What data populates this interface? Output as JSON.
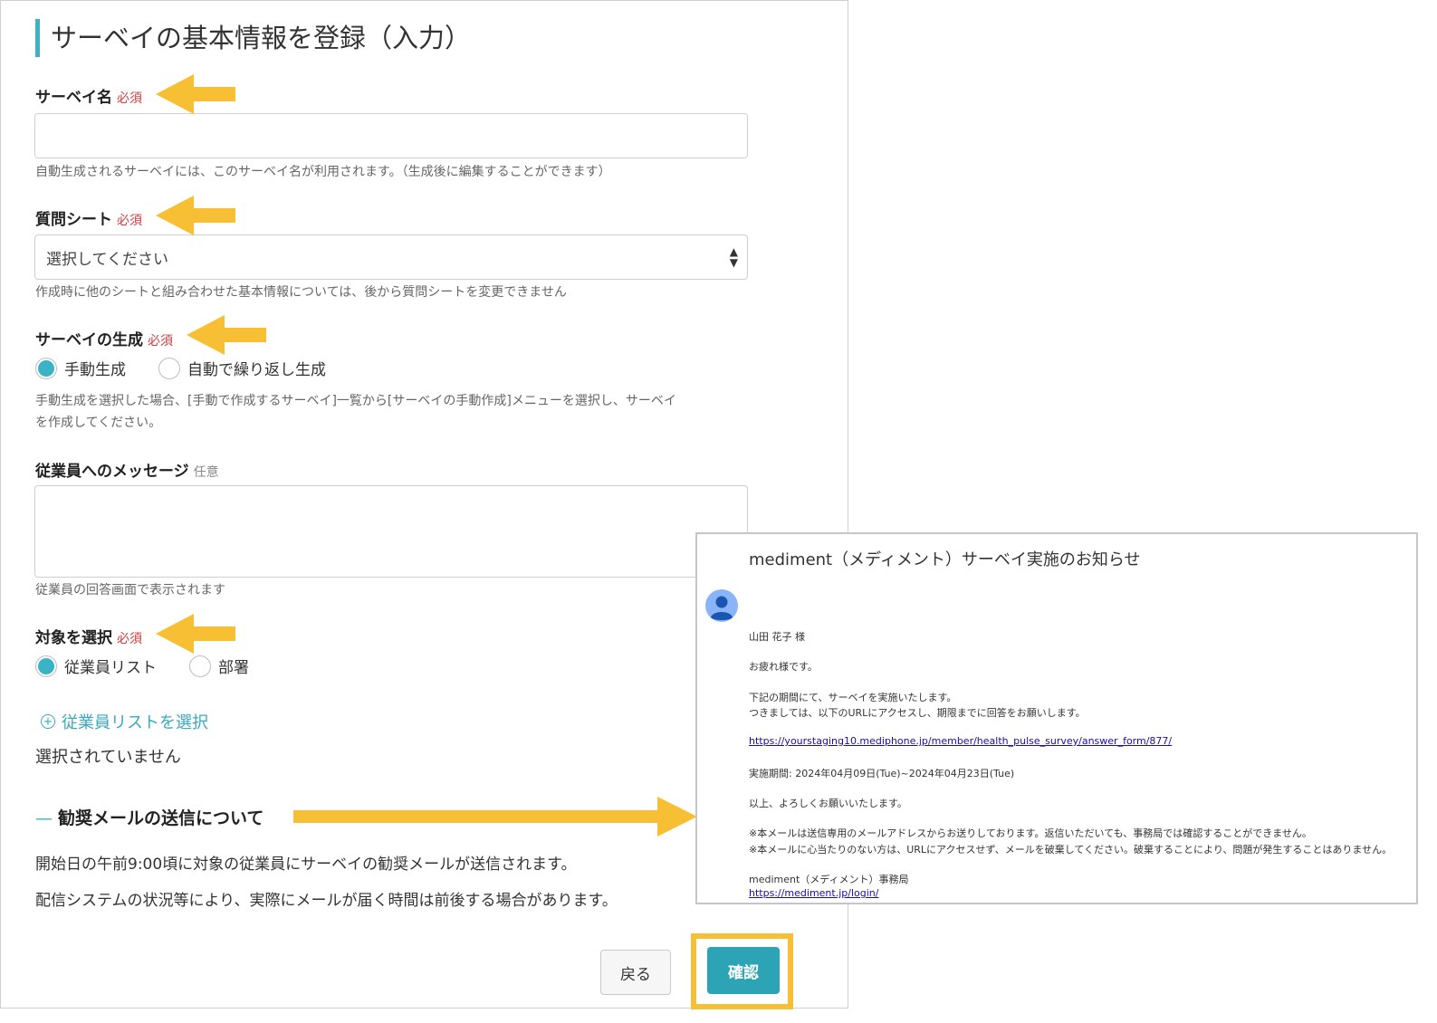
{
  "form": {
    "title": "サーベイの基本情報を登録（入力）",
    "required_badge": "必須",
    "optional_badge": "任意",
    "survey_name": {
      "label": "サーベイ名",
      "value": "",
      "help": "自動生成されるサーベイには、このサーベイ名が利用されます。（生成後に編集することができます）"
    },
    "question_sheet": {
      "label": "質問シート",
      "selected": "選択してください",
      "help": "作成時に他のシートと組み合わせた基本情報については、後から質問シートを変更できません"
    },
    "generation": {
      "label": "サーベイの生成",
      "options": [
        "手動生成",
        "自動で繰り返し生成"
      ],
      "selected": "手動生成",
      "help_line1": "手動生成を選択した場合、[手動で作成するサーベイ]一覧から[サーベイの手動作成]メニューを選択し、サーベイ",
      "help_line2": "を作成してください。"
    },
    "message": {
      "label": "従業員へのメッセージ",
      "value": "",
      "help": "従業員の回答画面で表示されます"
    },
    "target": {
      "label": "対象を選択",
      "options": [
        "従業員リスト",
        "部署"
      ],
      "selected": "従業員リスト",
      "select_link": "従業員リストを選択",
      "none_selected": "選択されていません"
    },
    "reminder": {
      "heading": "勧奨メールの送信について",
      "line1": "開始日の午前9:00頃に対象の従業員にサーベイの勧奨メールが送信されます。",
      "line2": "配信システムの状況等により、実際にメールが届く時間は前後する場合があります。"
    },
    "buttons": {
      "back": "戻る",
      "confirm": "確認"
    }
  },
  "email": {
    "subject": "mediment（メディメント）サーベイ実施のお知らせ",
    "recipient": "山田 花子 様",
    "greeting": "お疲れ様です。",
    "body1": "下記の期間にて、サーベイを実施いたします。",
    "body2": "つきましては、以下のURLにアクセスし、期限までに回答をお願いします。",
    "survey_url": "https://yourstaging10.mediphone.jp/member/health_pulse_survey/answer_form/877/",
    "period": "実施期間: 2024年04月09日(Tue)~2024年04月23日(Tue)",
    "closing": "以上、よろしくお願いいたします。",
    "note1": "※本メールは送信専用のメールアドレスからお送りしております。返信いただいても、事務局では確認することができません。",
    "note2": "※本メールに心当たりのない方は、URLにアクセスせず、メールを破棄してください。破棄することにより、問題が発生することはありません。",
    "signature": "mediment（メディメント）事務局",
    "login_url": "https://mediment.jp/login/"
  },
  "colors": {
    "accent": "#3ab3c6",
    "required": "#d23c3c",
    "confirm_button": "#2da4b6",
    "highlight_arrow": "#f7c034",
    "link": "#1a0dab"
  },
  "icons": {
    "sheet_select": "updown-caret-icon",
    "add_target": "plus-circle-icon",
    "sender": "user-avatar-icon",
    "annotation": "arrow-left-icon"
  }
}
